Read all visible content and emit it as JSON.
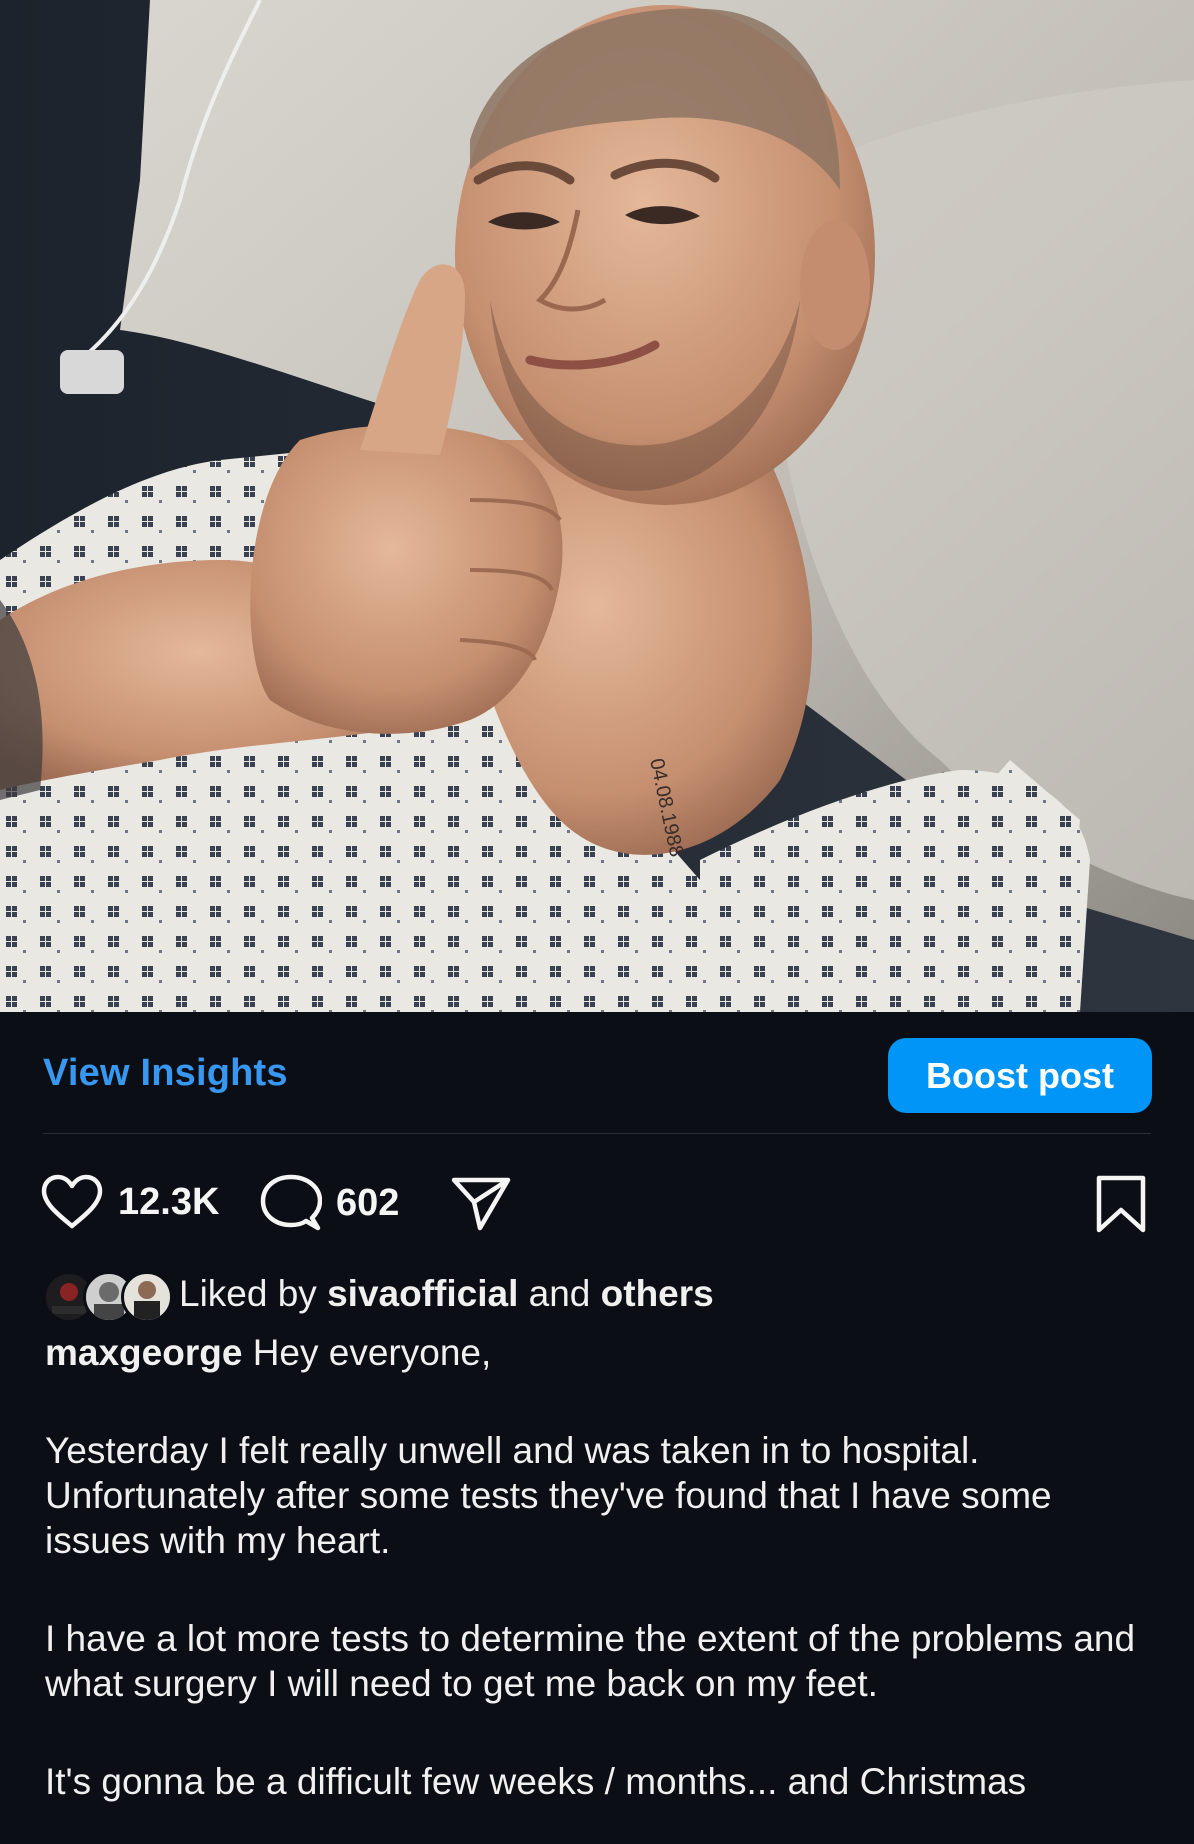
{
  "post": {
    "image_alt": "man in hospital gown giving a thumbs up from a hospital bed"
  },
  "actions": {
    "view_insights": "View Insights",
    "boost_post": "Boost post",
    "likes_count": "12.3K",
    "comments_count": "602"
  },
  "liked_by": {
    "prefix": "Liked by ",
    "user": "sivaofficial",
    "middle": " and ",
    "others": "others"
  },
  "caption": {
    "username": "maxgeorge",
    "first_line": " Hey everyone,",
    "paragraph_1": "Yesterday I felt really unwell and was taken in to hospital. Unfortunately after some tests they've found that I have some issues with my heart.",
    "paragraph_2": "I have a lot more tests to determine the extent of the problems and what surgery I will need to get me back on my feet.",
    "paragraph_3": "It's gonna be a difficult few weeks / months... and Christmas"
  },
  "colors": {
    "background": "#0b0e14",
    "link_blue": "#3897f0",
    "button_blue": "#0095f6"
  },
  "icons": [
    "heart-icon",
    "comment-icon",
    "share-icon",
    "bookmark-icon"
  ]
}
